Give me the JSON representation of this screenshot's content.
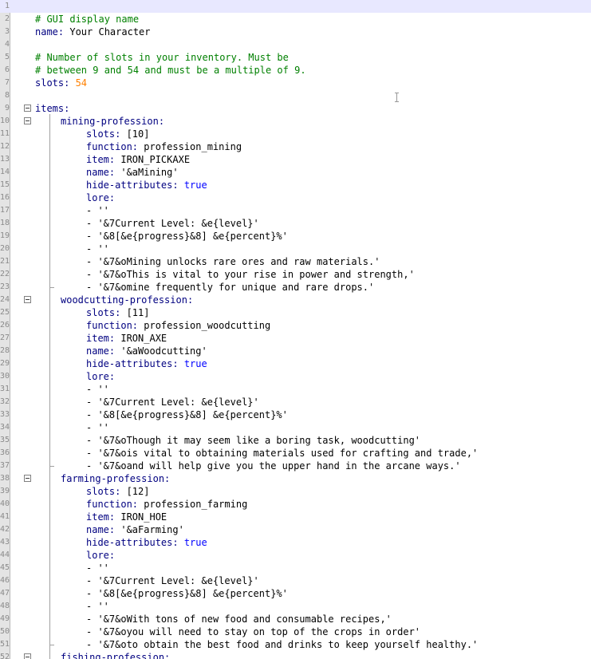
{
  "editor": {
    "lines": [
      {
        "n": "1",
        "indent": 0,
        "tokens": []
      },
      {
        "n": "2",
        "indent": 0,
        "tokens": [
          {
            "t": "# GUI display name",
            "c": "comment"
          }
        ]
      },
      {
        "n": "3",
        "indent": 0,
        "tokens": [
          {
            "t": "name:",
            "c": "key"
          },
          {
            "t": " Your Character",
            "c": "val"
          }
        ]
      },
      {
        "n": "4",
        "indent": 0,
        "tokens": []
      },
      {
        "n": "5",
        "indent": 0,
        "tokens": [
          {
            "t": "# Number of slots in your inventory. Must be",
            "c": "comment"
          }
        ]
      },
      {
        "n": "6",
        "indent": 0,
        "tokens": [
          {
            "t": "# between 9 and 54 and must be a multiple of 9.",
            "c": "comment"
          }
        ]
      },
      {
        "n": "7",
        "indent": 0,
        "tokens": [
          {
            "t": "slots:",
            "c": "key"
          },
          {
            "t": " 54",
            "c": "num"
          }
        ]
      },
      {
        "n": "8",
        "indent": 0,
        "tokens": []
      },
      {
        "n": "9",
        "indent": 0,
        "fold": "open",
        "tokens": [
          {
            "t": "items:",
            "c": "key"
          }
        ]
      },
      {
        "n": "10",
        "indent": 4,
        "fold": "open",
        "tokens": [
          {
            "t": "mining-profession:",
            "c": "key"
          }
        ]
      },
      {
        "n": "11",
        "indent": 8,
        "tokens": [
          {
            "t": "slots:",
            "c": "key"
          },
          {
            "t": " [10]",
            "c": "val"
          }
        ]
      },
      {
        "n": "12",
        "indent": 8,
        "tokens": [
          {
            "t": "function:",
            "c": "key"
          },
          {
            "t": " profession_mining",
            "c": "val"
          }
        ]
      },
      {
        "n": "13",
        "indent": 8,
        "tokens": [
          {
            "t": "item:",
            "c": "key"
          },
          {
            "t": " IRON_PICKAXE",
            "c": "val"
          }
        ]
      },
      {
        "n": "14",
        "indent": 8,
        "tokens": [
          {
            "t": "name:",
            "c": "key"
          },
          {
            "t": " '&aMining'",
            "c": "val"
          }
        ]
      },
      {
        "n": "15",
        "indent": 8,
        "tokens": [
          {
            "t": "hide-attributes:",
            "c": "key"
          },
          {
            "t": " true",
            "c": "bool"
          }
        ]
      },
      {
        "n": "16",
        "indent": 8,
        "tokens": [
          {
            "t": "lore:",
            "c": "key"
          }
        ]
      },
      {
        "n": "17",
        "indent": 8,
        "tokens": [
          {
            "t": "- ''",
            "c": "val"
          }
        ]
      },
      {
        "n": "18",
        "indent": 8,
        "tokens": [
          {
            "t": "- '&7Current Level: &e{level}'",
            "c": "val"
          }
        ]
      },
      {
        "n": "19",
        "indent": 8,
        "tokens": [
          {
            "t": "- '&8[&e{progress}&8] &e{percent}%'",
            "c": "val"
          }
        ]
      },
      {
        "n": "20",
        "indent": 8,
        "tokens": [
          {
            "t": "- ''",
            "c": "val"
          }
        ]
      },
      {
        "n": "21",
        "indent": 8,
        "tokens": [
          {
            "t": "- '&7&oMining unlocks rare ores and raw materials.'",
            "c": "val"
          }
        ]
      },
      {
        "n": "22",
        "indent": 8,
        "tokens": [
          {
            "t": "- '&7&oThis is vital to your rise in power and strength,'",
            "c": "val"
          }
        ]
      },
      {
        "n": "23",
        "indent": 8,
        "fold": "end",
        "tokens": [
          {
            "t": "- '&7&omine frequently for unique and rare drops.'",
            "c": "val"
          }
        ]
      },
      {
        "n": "24",
        "indent": 4,
        "fold": "open",
        "tokens": [
          {
            "t": "woodcutting-profession:",
            "c": "key"
          }
        ]
      },
      {
        "n": "25",
        "indent": 8,
        "tokens": [
          {
            "t": "slots:",
            "c": "key"
          },
          {
            "t": " [11]",
            "c": "val"
          }
        ]
      },
      {
        "n": "26",
        "indent": 8,
        "tokens": [
          {
            "t": "function:",
            "c": "key"
          },
          {
            "t": " profession_woodcutting",
            "c": "val"
          }
        ]
      },
      {
        "n": "27",
        "indent": 8,
        "tokens": [
          {
            "t": "item:",
            "c": "key"
          },
          {
            "t": " IRON_AXE",
            "c": "val"
          }
        ]
      },
      {
        "n": "28",
        "indent": 8,
        "tokens": [
          {
            "t": "name:",
            "c": "key"
          },
          {
            "t": " '&aWoodcutting'",
            "c": "val"
          }
        ]
      },
      {
        "n": "29",
        "indent": 8,
        "tokens": [
          {
            "t": "hide-attributes:",
            "c": "key"
          },
          {
            "t": " true",
            "c": "bool"
          }
        ]
      },
      {
        "n": "30",
        "indent": 8,
        "tokens": [
          {
            "t": "lore:",
            "c": "key"
          }
        ]
      },
      {
        "n": "31",
        "indent": 8,
        "tokens": [
          {
            "t": "- ''",
            "c": "val"
          }
        ]
      },
      {
        "n": "32",
        "indent": 8,
        "tokens": [
          {
            "t": "- '&7Current Level: &e{level}'",
            "c": "val"
          }
        ]
      },
      {
        "n": "33",
        "indent": 8,
        "tokens": [
          {
            "t": "- '&8[&e{progress}&8] &e{percent}%'",
            "c": "val"
          }
        ]
      },
      {
        "n": "34",
        "indent": 8,
        "tokens": [
          {
            "t": "- ''",
            "c": "val"
          }
        ]
      },
      {
        "n": "35",
        "indent": 8,
        "tokens": [
          {
            "t": "- '&7&oThough it may seem like a boring task, woodcutting'",
            "c": "val"
          }
        ]
      },
      {
        "n": "36",
        "indent": 8,
        "tokens": [
          {
            "t": "- '&7&ois vital to obtaining materials used for crafting and trade,'",
            "c": "val"
          }
        ]
      },
      {
        "n": "37",
        "indent": 8,
        "fold": "end",
        "tokens": [
          {
            "t": "- '&7&oand will help give you the upper hand in the arcane ways.'",
            "c": "val"
          }
        ]
      },
      {
        "n": "38",
        "indent": 4,
        "fold": "open",
        "tokens": [
          {
            "t": "farming-profession:",
            "c": "key"
          }
        ]
      },
      {
        "n": "39",
        "indent": 8,
        "tokens": [
          {
            "t": "slots:",
            "c": "key"
          },
          {
            "t": " [12]",
            "c": "val"
          }
        ]
      },
      {
        "n": "40",
        "indent": 8,
        "tokens": [
          {
            "t": "function:",
            "c": "key"
          },
          {
            "t": " profession_farming",
            "c": "val"
          }
        ]
      },
      {
        "n": "41",
        "indent": 8,
        "tokens": [
          {
            "t": "item:",
            "c": "key"
          },
          {
            "t": " IRON_HOE",
            "c": "val"
          }
        ]
      },
      {
        "n": "42",
        "indent": 8,
        "tokens": [
          {
            "t": "name:",
            "c": "key"
          },
          {
            "t": " '&aFarming'",
            "c": "val"
          }
        ]
      },
      {
        "n": "43",
        "indent": 8,
        "tokens": [
          {
            "t": "hide-attributes:",
            "c": "key"
          },
          {
            "t": " true",
            "c": "bool"
          }
        ]
      },
      {
        "n": "44",
        "indent": 8,
        "tokens": [
          {
            "t": "lore:",
            "c": "key"
          }
        ]
      },
      {
        "n": "45",
        "indent": 8,
        "tokens": [
          {
            "t": "- ''",
            "c": "val"
          }
        ]
      },
      {
        "n": "46",
        "indent": 8,
        "tokens": [
          {
            "t": "- '&7Current Level: &e{level}'",
            "c": "val"
          }
        ]
      },
      {
        "n": "47",
        "indent": 8,
        "tokens": [
          {
            "t": "- '&8[&e{progress}&8] &e{percent}%'",
            "c": "val"
          }
        ]
      },
      {
        "n": "48",
        "indent": 8,
        "tokens": [
          {
            "t": "- ''",
            "c": "val"
          }
        ]
      },
      {
        "n": "49",
        "indent": 8,
        "tokens": [
          {
            "t": "- '&7&oWith tons of new food and consumable recipes,'",
            "c": "val"
          }
        ]
      },
      {
        "n": "50",
        "indent": 8,
        "tokens": [
          {
            "t": "- '&7&oyou will need to stay on top of the crops in order'",
            "c": "val"
          }
        ]
      },
      {
        "n": "51",
        "indent": 8,
        "fold": "end",
        "tokens": [
          {
            "t": "- '&7&oto obtain the best food and drinks to keep yourself healthy.'",
            "c": "val"
          }
        ]
      },
      {
        "n": "52",
        "indent": 4,
        "fold": "open",
        "tokens": [
          {
            "t": "fishing-profession:",
            "c": "key"
          }
        ]
      }
    ]
  }
}
